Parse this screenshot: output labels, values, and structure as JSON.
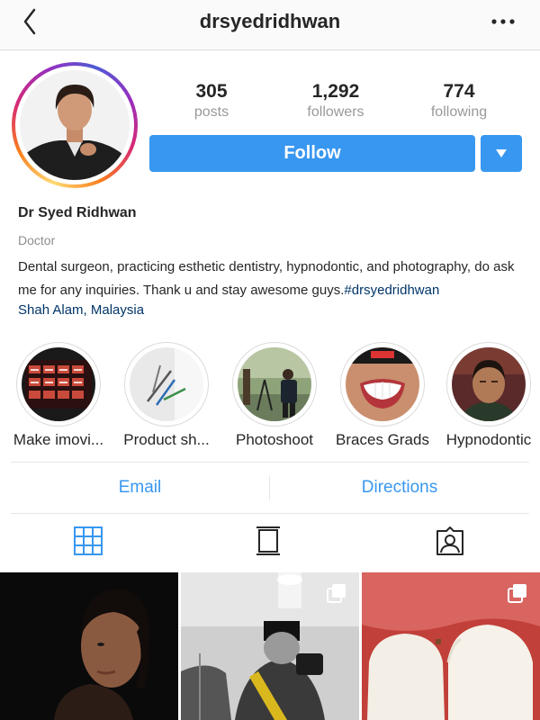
{
  "header": {
    "username": "drsyedridhwan"
  },
  "profile": {
    "stats": {
      "posts": {
        "value": "305",
        "label": "posts"
      },
      "followers": {
        "value": "1,292",
        "label": "followers"
      },
      "following": {
        "value": "774",
        "label": "following"
      }
    },
    "follow_label": "Follow",
    "name": "Dr Syed Ridhwan",
    "category": "Doctor",
    "bio": "Dental surgeon, practicing esthetic dentistry, hypnodontic, and photography, do ask me for any inquiries. Thank u and stay awesome guys.",
    "hashtag": "#drsyedridhwan",
    "location": "Shah Alam, Malaysia"
  },
  "highlights": [
    {
      "label": "Make imovi..."
    },
    {
      "label": "Product sh..."
    },
    {
      "label": "Photoshoot"
    },
    {
      "label": "Braces Grads"
    },
    {
      "label": "Hypnodontic"
    }
  ],
  "actions": {
    "email": "Email",
    "directions": "Directions"
  },
  "tabs": [
    {
      "icon": "grid-icon",
      "active": true
    },
    {
      "icon": "feed-icon",
      "active": false
    },
    {
      "icon": "tagged-icon",
      "active": false
    }
  ],
  "colors": {
    "accent": "#3897f0",
    "link": "#003569",
    "muted": "#999999"
  }
}
